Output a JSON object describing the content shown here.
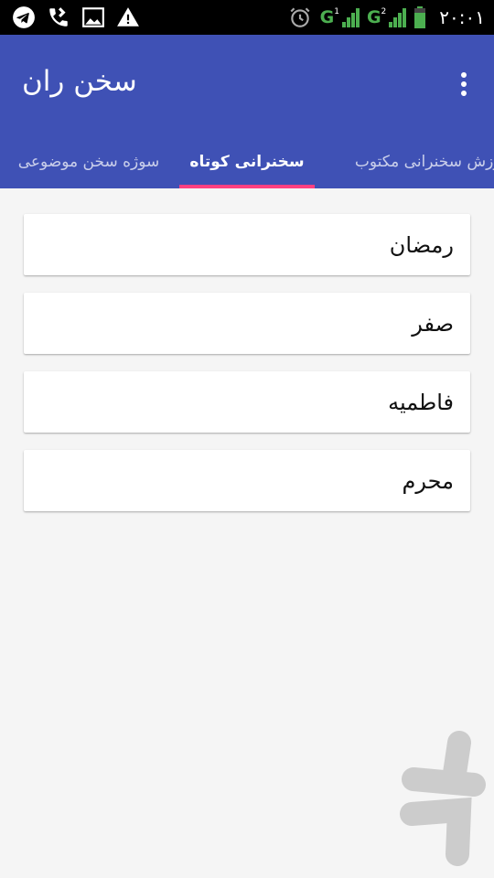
{
  "status_bar": {
    "time": "۲۰:۰۱",
    "icons": [
      "telegram-icon",
      "missed-call-icon",
      "image-icon",
      "warning-icon",
      "alarm-icon",
      "signal-icon",
      "battery-icon"
    ],
    "network": [
      {
        "letter": "G",
        "sim": "1"
      },
      {
        "letter": "G",
        "sim": "2"
      }
    ]
  },
  "app_bar": {
    "title": "سخن ران",
    "menu_icon": "more-vert-icon",
    "color": "#3f51b5"
  },
  "tabs": [
    {
      "label": "آموزش سخنرانی مکتوب",
      "active": false
    },
    {
      "label": "سخنرانی کوتاه",
      "active": true
    },
    {
      "label": "سوژه سخن موضوعی",
      "active": false
    }
  ],
  "list_items": [
    {
      "label": "رمضان"
    },
    {
      "label": "صفر"
    },
    {
      "label": "فاطمیه"
    },
    {
      "label": "محرم"
    }
  ],
  "colors": {
    "accent": "#ff4081",
    "background": "#f5f5f5",
    "watermark": "#cccccc"
  }
}
